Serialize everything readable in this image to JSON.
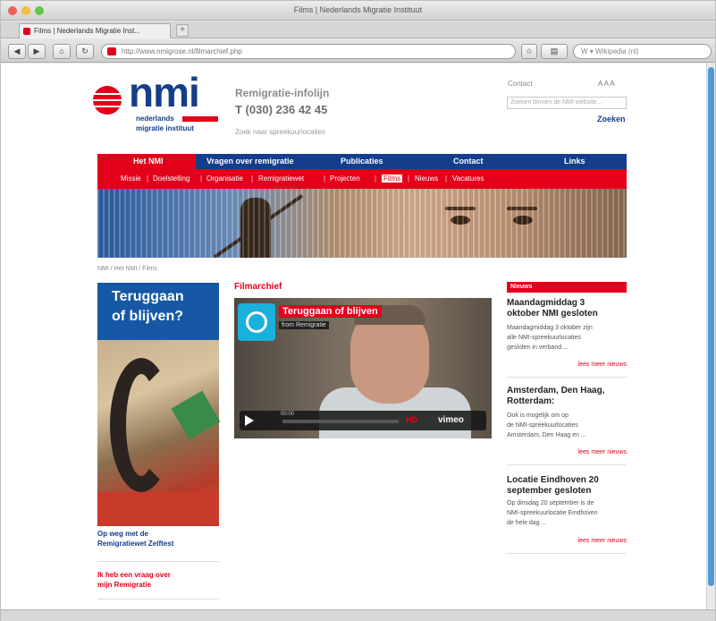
{
  "window": {
    "title": "Films | Nederlands Migratie Instituut"
  },
  "tab": {
    "label": "Films | Nederlands Migratie Inst..."
  },
  "toolbar": {
    "back": "◀",
    "forward": "▶",
    "home": "⌂",
    "reload": "↻",
    "url": "http://www.nmigrose.nl/filmarchief.php",
    "search_placeholder": "W ▾ Wikipedia (nl)"
  },
  "header": {
    "logo_text": "nmi",
    "logo_sub1": "nederlands",
    "logo_sub2": "migratie instituut",
    "infolijn_label": "Remigratie-infolijn",
    "phone": "T (030) 236 42 45",
    "zoek_link": "Zoek naar spreekuurlocaties",
    "contact": "Contact",
    "font_size": "A A A",
    "search_placeholder": "Zoeken binnen de NMI website...",
    "search_button": "Zoeken"
  },
  "nav_main": [
    "Het NMI",
    "Vragen over remigratie",
    "Publicaties",
    "Contact",
    "Links"
  ],
  "nav_sub": [
    "Missie",
    "Doelstelling",
    "Organisatie",
    "Remigratiewet",
    "Projecten",
    "Films",
    "Nieuws",
    "Vacatures"
  ],
  "breadcrumb": "NMI / Het NMI / Films",
  "left_ad": {
    "line1": "Teruggaan",
    "line2": "of blijven?",
    "link1_line1": "Op weg met de",
    "link1_line2": "Remigratiewet Zelftest",
    "link2_line1": "Ik heb een vraag over",
    "link2_line2": "mijn Remigratie"
  },
  "film": {
    "section_title": "Filmarchief",
    "video_title": "Teruggaan of blijven",
    "video_sub": "from Remigratie",
    "time": "00:00",
    "hd": "HD",
    "vimeo": "vimeo"
  },
  "news": {
    "header": "Nieuws",
    "items": [
      {
        "title_l1": "Maandagmiddag 3",
        "title_l2": "oktober NMI gesloten",
        "text": [
          "Maandagmiddag 3 oktober zijn",
          "alle NMI-spreekuurlocaties",
          "gesloten in verband ..."
        ],
        "more": "lees meer nieuws"
      },
      {
        "title_l1": "Amsterdam, Den Haag,",
        "title_l2": "Rotterdam:",
        "text": [
          "Ook is mogelijk om op",
          "de NMI-spreekuurlocaties",
          "Amsterdam, Den Haag en ..."
        ],
        "more": "lees meer nieuws"
      },
      {
        "title_l1": "Locatie Eindhoven 20",
        "title_l2": "september gesloten",
        "text": [
          "Op dinsdag 20 september is de",
          "NMI-spreekuurlocatie Eindhoven",
          "de hele dag ..."
        ],
        "more": "lees meer nieuws"
      }
    ]
  },
  "colors": {
    "brand_red": "#e2001a",
    "brand_blue": "#143e8c"
  }
}
